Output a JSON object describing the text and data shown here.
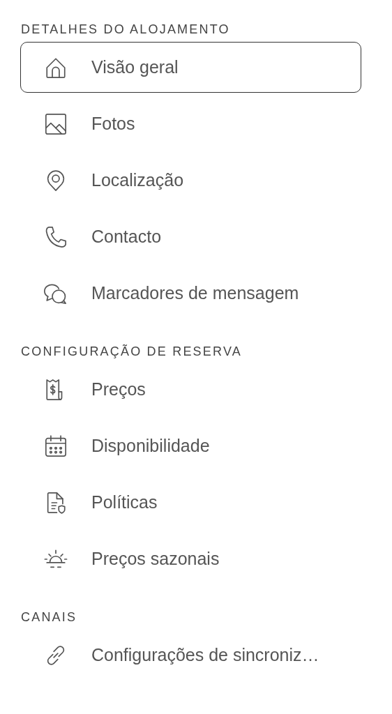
{
  "sections": [
    {
      "title": "DETALHES DO ALOJAMENTO",
      "items": [
        {
          "kind": "house",
          "label": "Visão geral",
          "selected": true
        },
        {
          "kind": "image",
          "label": "Fotos",
          "selected": false
        },
        {
          "kind": "pin",
          "label": "Localização",
          "selected": false
        },
        {
          "kind": "phone",
          "label": "Contacto",
          "selected": false
        },
        {
          "kind": "chat",
          "label": "Marcadores de mensagem",
          "selected": false
        }
      ]
    },
    {
      "title": "CONFIGURAÇÃO DE RESERVA",
      "items": [
        {
          "kind": "receipt",
          "label": "Preços",
          "selected": false
        },
        {
          "kind": "calendar",
          "label": "Disponibilidade",
          "selected": false
        },
        {
          "kind": "policy",
          "label": "Políticas",
          "selected": false
        },
        {
          "kind": "sun",
          "label": "Preços sazonais",
          "selected": false
        }
      ]
    },
    {
      "title": "CANAIS",
      "items": [
        {
          "kind": "link",
          "label": "Configurações de sincroniz…",
          "selected": false
        }
      ]
    }
  ]
}
